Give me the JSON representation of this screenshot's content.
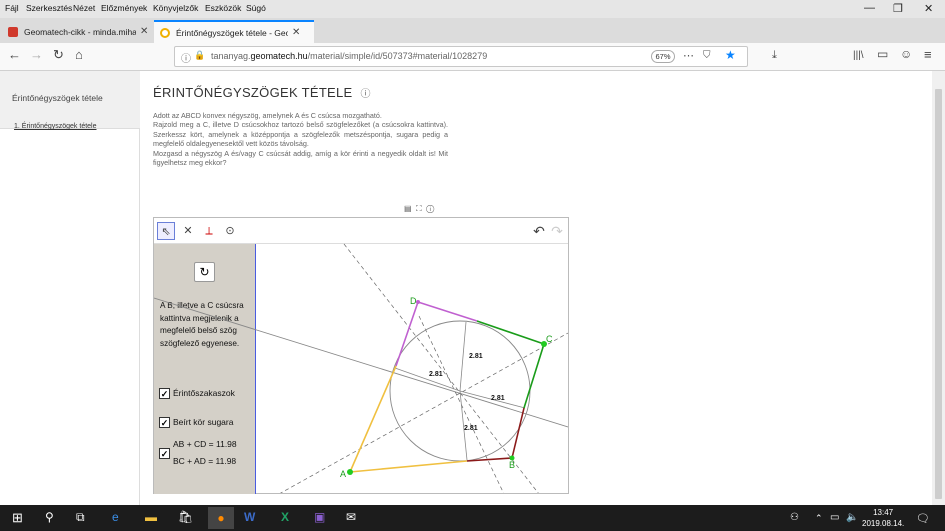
{
  "menubar": {
    "items": [
      "Fájl",
      "Szerkesztés",
      "Nézet",
      "Előzmények",
      "Könyvjelzők",
      "Eszközök",
      "Súgó"
    ],
    "minimize": "—",
    "restore": "❐",
    "close": "✕"
  },
  "tabs": [
    {
      "title": "Geomatech-cikk - minda.mihal",
      "active": false,
      "color": "#d0392c"
    },
    {
      "title": "Érintőnégyszögek tétele - GeoG",
      "active": true,
      "color": "#f0b000"
    }
  ],
  "newtab": "+",
  "nav": {
    "back": "←",
    "forward": "→",
    "reload": "↻",
    "home": "⌂",
    "url_prefix": "tananyag.",
    "url_domain": "geomatech.hu",
    "url_path": "/material/simple/id/507373#material/1028279",
    "zoom": "67%",
    "more": "⋯",
    "bookmark": "★",
    "library": "|||\\",
    "sidebar": "▭",
    "account": "☺",
    "menu": "≡"
  },
  "sidebar": {
    "title": "Érintőnégyszögek tétele",
    "item": "1. Érintőnégyszögek tétele"
  },
  "page": {
    "title": "ÉRINTŐNÉGYSZÖGEK TÉTELE",
    "title_icon": "ⓘ",
    "p1": "Adott az ABCD konvex négyszög, amelynek A és C csúcsa mozgatható.",
    "p2": "Rajzold meg a C, illetve D csúcsokhoz tartozó belső szögfelezőket (a csúcsokra kattintva). Szerkessz kört, amelynek a középpontja a szögfelezők metszéspontja, sugara pedig a megfelelő oldalegyenesektől vett közös távolság.",
    "p3": "Mozgasd a négyszög A és/vagy C csúcsát addig, amíg a kör érinti a negyedik oldalt is! Mit figyelhetsz meg ekkor?"
  },
  "applet": {
    "icons": [
      "▤",
      "⛶",
      "ⓘ"
    ],
    "tools": [
      "⇖",
      "✕",
      "⟂",
      "⊙"
    ],
    "undo": "↶",
    "redo": "↷",
    "reset": "↻",
    "info": "A B, illetve a C csúcsra kattintva megjelenik a megfelelő belső szög szögfelező egyenese.",
    "checks": [
      {
        "label": "Érintőszakaszok",
        "checked": true
      },
      {
        "label": "Beírt kör sugara",
        "checked": true
      }
    ],
    "sum1": "AB + CD = 11.98",
    "sum2": "BC + AD = 11.98",
    "points": {
      "A": "A",
      "B": "B",
      "C": "C",
      "D": "D"
    },
    "radius_label": "2.81",
    "colors": {
      "AB": "#8b1a1a",
      "BC": "#1a9c1a",
      "CD": "#1a9c1a",
      "DA_top": "#c060d0",
      "DA_bottom": "#f0c040",
      "points": "#22cc22"
    }
  },
  "taskbar": {
    "time": "13:47",
    "date": "2019.08.14."
  }
}
